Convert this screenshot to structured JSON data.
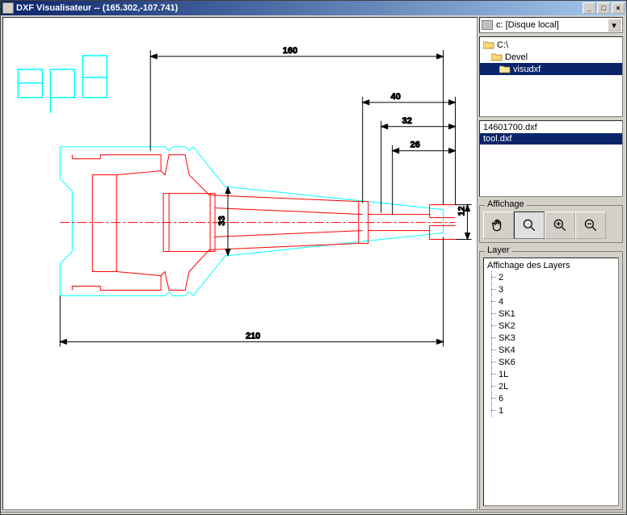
{
  "window": {
    "title": "DXF Visualisateur -- (165.302,-107.741)"
  },
  "drive": {
    "label": "c: [Disque local]"
  },
  "dirs": [
    {
      "name": "C:\\",
      "indent": 0,
      "sel": false
    },
    {
      "name": "Devel",
      "indent": 1,
      "sel": false
    },
    {
      "name": "visudxf",
      "indent": 2,
      "sel": true
    }
  ],
  "files": [
    {
      "name": "14601700.dxf",
      "sel": false
    },
    {
      "name": "tool.dxf",
      "sel": true
    }
  ],
  "groups": {
    "affichage": "Affichage",
    "layer": "Layer"
  },
  "layer_tree": {
    "root": "Affichage des Layers",
    "items": [
      "2",
      "3",
      "4",
      "SK1",
      "SK2",
      "SK3",
      "SK4",
      "SK6",
      "1L",
      "2L",
      "6",
      "1"
    ]
  },
  "dims": {
    "d160": "160",
    "d40": "40",
    "d32": "32",
    "d26": "26",
    "d33": "33",
    "d12": "12",
    "d210": "210"
  },
  "logo": "epb"
}
